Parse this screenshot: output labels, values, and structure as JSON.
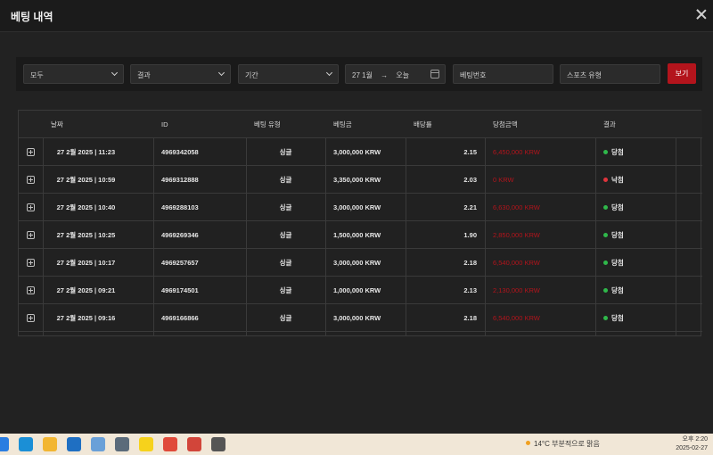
{
  "window": {
    "title": "베팅 내역"
  },
  "filters": {
    "type_select": "모두",
    "result_select": "결과",
    "period_select": "기간",
    "date_from": "27 1월",
    "date_arrow": "→",
    "date_to": "오늘",
    "bet_number_placeholder": "베팅번호",
    "sport_type_placeholder": "스포츠 유형",
    "view_button": "보기"
  },
  "table": {
    "headers": [
      "날짜",
      "ID",
      "베팅 유형",
      "베팅금",
      "배당률",
      "당첨금액",
      "결과"
    ],
    "rows": [
      {
        "date": "27 2월 2025 | 11:23",
        "id": "4969342058",
        "type": "싱글",
        "stake": "3,000,000 KRW",
        "odds": "2.15",
        "win": "6,450,000 KRW",
        "result": "당첨",
        "status": "won"
      },
      {
        "date": "27 2월 2025 | 10:59",
        "id": "4969312888",
        "type": "싱글",
        "stake": "3,350,000 KRW",
        "odds": "2.03",
        "win": "0 KRW",
        "result": "낙첨",
        "status": "lost"
      },
      {
        "date": "27 2월 2025 | 10:40",
        "id": "4969288103",
        "type": "싱글",
        "stake": "3,000,000 KRW",
        "odds": "2.21",
        "win": "6,630,000 KRW",
        "result": "당첨",
        "status": "won"
      },
      {
        "date": "27 2월 2025 | 10:25",
        "id": "4969269346",
        "type": "싱글",
        "stake": "1,500,000 KRW",
        "odds": "1.90",
        "win": "2,850,000 KRW",
        "result": "당첨",
        "status": "won"
      },
      {
        "date": "27 2월 2025 | 10:17",
        "id": "4969257657",
        "type": "싱글",
        "stake": "3,000,000 KRW",
        "odds": "2.18",
        "win": "6,540,000 KRW",
        "result": "당첨",
        "status": "won"
      },
      {
        "date": "27 2월 2025 | 09:21",
        "id": "4969174501",
        "type": "싱글",
        "stake": "1,000,000 KRW",
        "odds": "2.13",
        "win": "2,130,000 KRW",
        "result": "당첨",
        "status": "won"
      },
      {
        "date": "27 2월 2025 | 09:16",
        "id": "4969166866",
        "type": "싱글",
        "stake": "3,000,000 KRW",
        "odds": "2.18",
        "win": "6,540,000 KRW",
        "result": "당첨",
        "status": "won"
      }
    ]
  },
  "colors": {
    "won": "#2fb84a",
    "lost": "#e0343c",
    "accent": "#b3141c"
  },
  "taskbar": {
    "weather": "14°C 부분적으로 맑음",
    "time": "오후 2:20",
    "date": "2025-02-27",
    "icons": [
      "windows-icon",
      "edge-icon",
      "file-explorer-icon",
      "outlook-icon",
      "app-icon",
      "calculator-icon",
      "kakaotalk-icon",
      "chrome-icon",
      "game-icon",
      "settings-icon"
    ]
  }
}
